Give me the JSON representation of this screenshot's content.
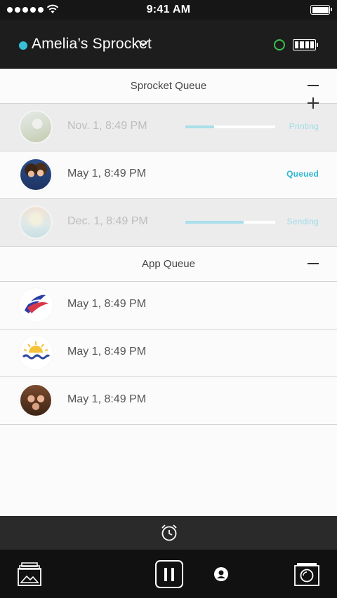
{
  "status_bar": {
    "time": "9:41 AM",
    "signal_icon": "signal-dots-icon",
    "wifi_icon": "wifi-icon",
    "battery_icon": "battery-icon"
  },
  "header": {
    "device_name": "Amelia’s Sprocket",
    "status_dot_color": "#36bfd9",
    "connection_color": "#3bc24a",
    "chevron_icon": "chevron-down-icon",
    "printer_battery_icon": "battery-full-icon"
  },
  "sprocket_queue": {
    "title": "Sprocket Queue",
    "items": [
      {
        "time": "Nov. 1, 8:49 PM",
        "status": "Printing",
        "progress": 0.32,
        "thumbnail": "landscape-photo"
      },
      {
        "time": "May 1, 8:49 PM",
        "status": "Queued",
        "thumbnail": "friends-selfie-photo"
      },
      {
        "time": "Dec. 1, 8:49 PM",
        "status": "Sending",
        "progress": 0.65,
        "thumbnail": "pastel-sky-photo"
      }
    ]
  },
  "app_queue": {
    "title": "App Queue",
    "items": [
      {
        "time": "May 1, 8:49 PM",
        "thumbnail": "brush-stroke-art"
      },
      {
        "time": "May 1, 8:49 PM",
        "thumbnail": "summer-sun-art"
      },
      {
        "time": "May 1, 8:49 PM",
        "thumbnail": "group-selfie-photo"
      }
    ]
  },
  "colors": {
    "accent": "#36bfd9",
    "header_bg": "#1d1d1d",
    "tab_bar_bg": "#111111"
  },
  "bottom": {
    "timer_icon": "timer-icon",
    "gallery_icon": "gallery-icon",
    "pause_icon": "pause-icon",
    "profile_icon": "profile-icon",
    "camera_icon": "camera-icon"
  }
}
